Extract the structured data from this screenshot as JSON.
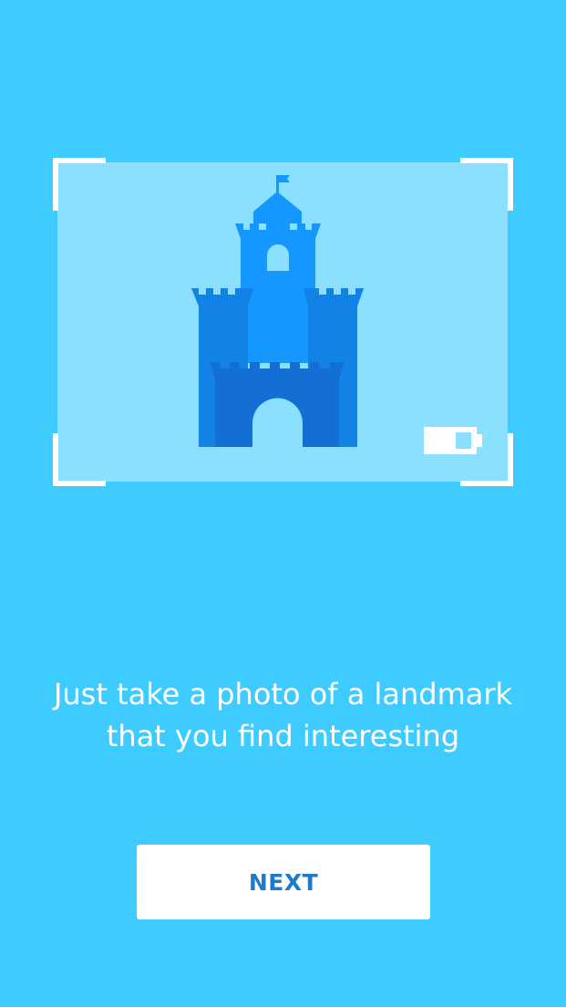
{
  "colors": {
    "background": "#3ECBFF",
    "viewfinder": "#8CE0FF",
    "castle_main": "#1498FF",
    "castle_side": "#1382E6",
    "castle_front": "#136FD4",
    "button_text": "#1D7BC9"
  },
  "illustration": {
    "subject_icon": "castle-icon",
    "indicator_icon": "battery-icon"
  },
  "caption": {
    "line1": "Just take a photo of a landmark",
    "line2": "that you find interesting"
  },
  "next_button": {
    "label": "NEXT"
  }
}
